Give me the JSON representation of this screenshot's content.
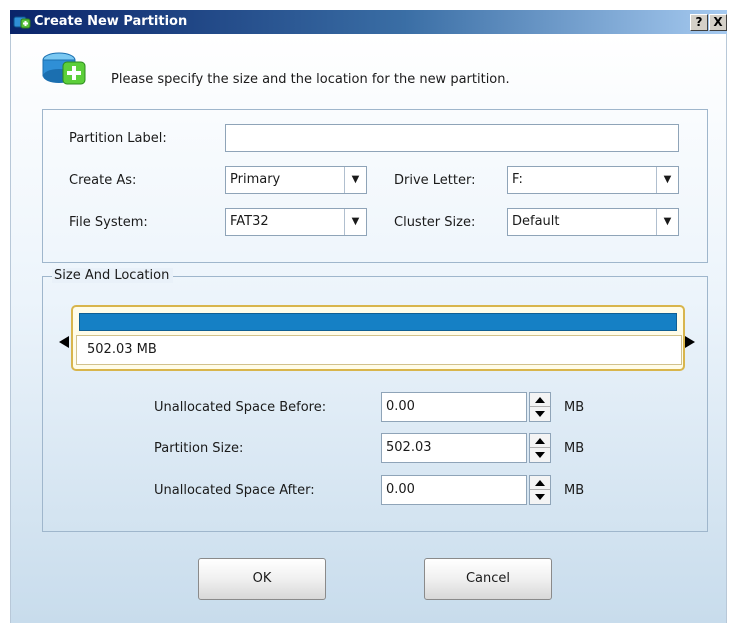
{
  "window": {
    "title": "Create New Partition",
    "help_label": "?",
    "close_label": "X"
  },
  "header": {
    "text": "Please specify the size and the location for the new partition."
  },
  "form": {
    "partition_label": {
      "label": "Partition Label:",
      "value": ""
    },
    "create_as": {
      "label": "Create As:",
      "value": "Primary"
    },
    "drive_letter": {
      "label": "Drive Letter:",
      "value": "F:"
    },
    "file_system": {
      "label": "File System:",
      "value": "FAT32"
    },
    "cluster_size": {
      "label": "Cluster Size:",
      "value": "Default"
    }
  },
  "size_location": {
    "legend": "Size And Location",
    "bar_text": "502.03 MB",
    "fields": [
      {
        "label": "Unallocated Space Before:",
        "value": "0.00",
        "unit": "MB"
      },
      {
        "label": "Partition Size:",
        "value": "502.03",
        "unit": "MB"
      },
      {
        "label": "Unallocated Space After:",
        "value": "0.00",
        "unit": "MB"
      }
    ]
  },
  "buttons": {
    "ok": "OK",
    "cancel": "Cancel"
  },
  "icons": {
    "app": "partition-icon",
    "header": "new-partition-icon"
  },
  "colors": {
    "bar_fill": "#1580c5",
    "bar_border": "#d8b54c"
  }
}
